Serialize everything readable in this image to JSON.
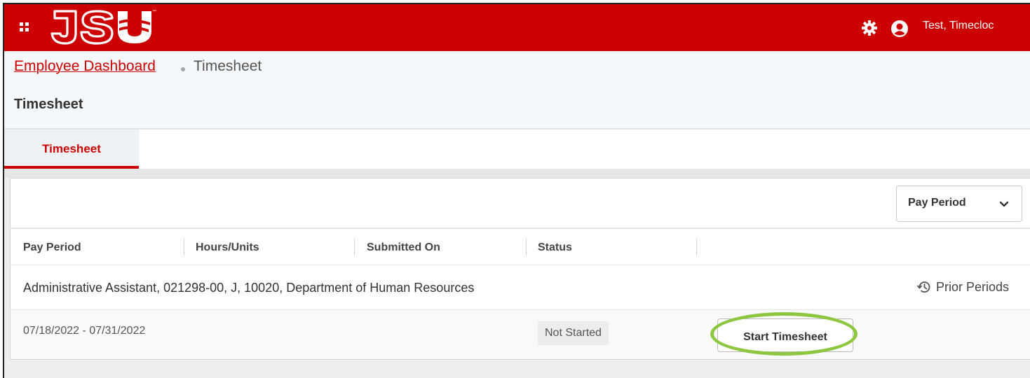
{
  "header": {
    "logo_text": "JSU",
    "user_name": "Test, Timecloc",
    "icons": [
      "apps-grid-icon",
      "gear-icon",
      "user-icon"
    ]
  },
  "breadcrumb": {
    "parent": "Employee Dashboard",
    "current": "Timesheet"
  },
  "page": {
    "title": "Timesheet"
  },
  "tabs": [
    {
      "label": "Timesheet",
      "active": true
    }
  ],
  "filter": {
    "selected": "Pay Period"
  },
  "table": {
    "columns": [
      "Pay Period",
      "Hours/Units",
      "Submitted On",
      "Status"
    ],
    "job": {
      "title": "Administrative Assistant, 021298-00, J, 10020, Department of Human Resources",
      "prior_periods_label": "Prior Periods"
    },
    "rows": [
      {
        "pay_period": "07/18/2022 - 07/31/2022",
        "status": "Not Started",
        "action_label": "Start Timesheet"
      }
    ]
  },
  "colors": {
    "brand_red": "#cc0000",
    "highlight_green": "#8dc63f"
  }
}
